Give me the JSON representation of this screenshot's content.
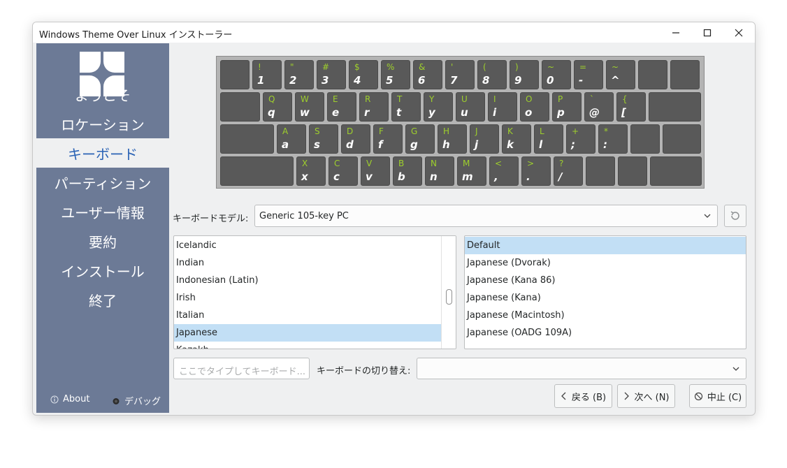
{
  "window": {
    "title": "Windows Theme Over Linux インストーラー"
  },
  "sidebar": {
    "items": [
      {
        "label": "ようこそ"
      },
      {
        "label": "ロケーション"
      },
      {
        "label": "キーボード"
      },
      {
        "label": "パーティション"
      },
      {
        "label": "ユーザー情報"
      },
      {
        "label": "要約"
      },
      {
        "label": "インストール"
      },
      {
        "label": "終了"
      }
    ],
    "active_index": 2,
    "about_label": "About",
    "debug_label": "デバッグ"
  },
  "keyboard": {
    "rows": [
      [
        {
          "s": "",
          "l": ""
        },
        {
          "s": "!",
          "l": "1"
        },
        {
          "s": "\"",
          "l": "2"
        },
        {
          "s": "#",
          "l": "3"
        },
        {
          "s": "$",
          "l": "4"
        },
        {
          "s": "%",
          "l": "5"
        },
        {
          "s": "&",
          "l": "6"
        },
        {
          "s": "'",
          "l": "7"
        },
        {
          "s": "(",
          "l": "8"
        },
        {
          "s": ")",
          "l": "9"
        },
        {
          "s": "~",
          "l": "0"
        },
        {
          "s": "=",
          "l": "-"
        },
        {
          "s": "~",
          "l": "^"
        },
        {
          "s": "",
          "l": ""
        },
        {
          "s": "",
          "l": ""
        }
      ],
      [
        {
          "s": "",
          "l": ""
        },
        {
          "s": "Q",
          "l": "q"
        },
        {
          "s": "W",
          "l": "w"
        },
        {
          "s": "E",
          "l": "e"
        },
        {
          "s": "R",
          "l": "r"
        },
        {
          "s": "T",
          "l": "t"
        },
        {
          "s": "Y",
          "l": "y"
        },
        {
          "s": "U",
          "l": "u"
        },
        {
          "s": "I",
          "l": "i"
        },
        {
          "s": "O",
          "l": "o"
        },
        {
          "s": "P",
          "l": "p"
        },
        {
          "s": "`",
          "l": "@"
        },
        {
          "s": "{",
          "l": "["
        },
        {
          "s": "",
          "l": ""
        }
      ],
      [
        {
          "s": "",
          "l": ""
        },
        {
          "s": "A",
          "l": "a"
        },
        {
          "s": "S",
          "l": "s"
        },
        {
          "s": "D",
          "l": "d"
        },
        {
          "s": "F",
          "l": "f"
        },
        {
          "s": "G",
          "l": "g"
        },
        {
          "s": "H",
          "l": "h"
        },
        {
          "s": "J",
          "l": "j"
        },
        {
          "s": "K",
          "l": "k"
        },
        {
          "s": "L",
          "l": "l"
        },
        {
          "s": "+",
          "l": ";"
        },
        {
          "s": "*",
          "l": ":"
        },
        {
          "s": "",
          "l": ""
        },
        {
          "s": "",
          "l": ""
        }
      ],
      [
        {
          "s": "",
          "l": ""
        },
        {
          "s": "X",
          "l": "x"
        },
        {
          "s": "C",
          "l": "c"
        },
        {
          "s": "V",
          "l": "v"
        },
        {
          "s": "B",
          "l": "b"
        },
        {
          "s": "N",
          "l": "n"
        },
        {
          "s": "M",
          "l": "m"
        },
        {
          "s": "<",
          "l": ","
        },
        {
          "s": ">",
          "l": "."
        },
        {
          "s": "?",
          "l": "/"
        },
        {
          "s": "",
          "l": ""
        },
        {
          "s": "",
          "l": ""
        },
        {
          "s": "",
          "l": ""
        }
      ]
    ]
  },
  "model": {
    "label": "キーボードモデル:",
    "value": "Generic 105-key PC"
  },
  "layouts": [
    {
      "label": "Icelandic"
    },
    {
      "label": "Indian"
    },
    {
      "label": "Indonesian (Latin)"
    },
    {
      "label": "Irish"
    },
    {
      "label": "Italian"
    },
    {
      "label": "Japanese"
    },
    {
      "label": "Kazakh"
    }
  ],
  "layouts_selected_index": 5,
  "variants": [
    {
      "label": "Default"
    },
    {
      "label": "Japanese (Dvorak)"
    },
    {
      "label": "Japanese (Kana 86)"
    },
    {
      "label": "Japanese (Kana)"
    },
    {
      "label": "Japanese (Macintosh)"
    },
    {
      "label": "Japanese (OADG 109A)"
    }
  ],
  "variants_selected_index": 0,
  "test_input": {
    "placeholder": "ここでタイプしてキーボード..."
  },
  "switch": {
    "label": "キーボードの切り替え:",
    "value": ""
  },
  "buttons": {
    "back": "戻る (B)",
    "next": "次へ (N)",
    "cancel": "中止 (C)"
  },
  "colors": {
    "sidebar": "#6c7a96",
    "accent": "#2b63b5",
    "key": "#595959",
    "key_shift": "#9ecf2c",
    "selection": "#c2dff5"
  }
}
